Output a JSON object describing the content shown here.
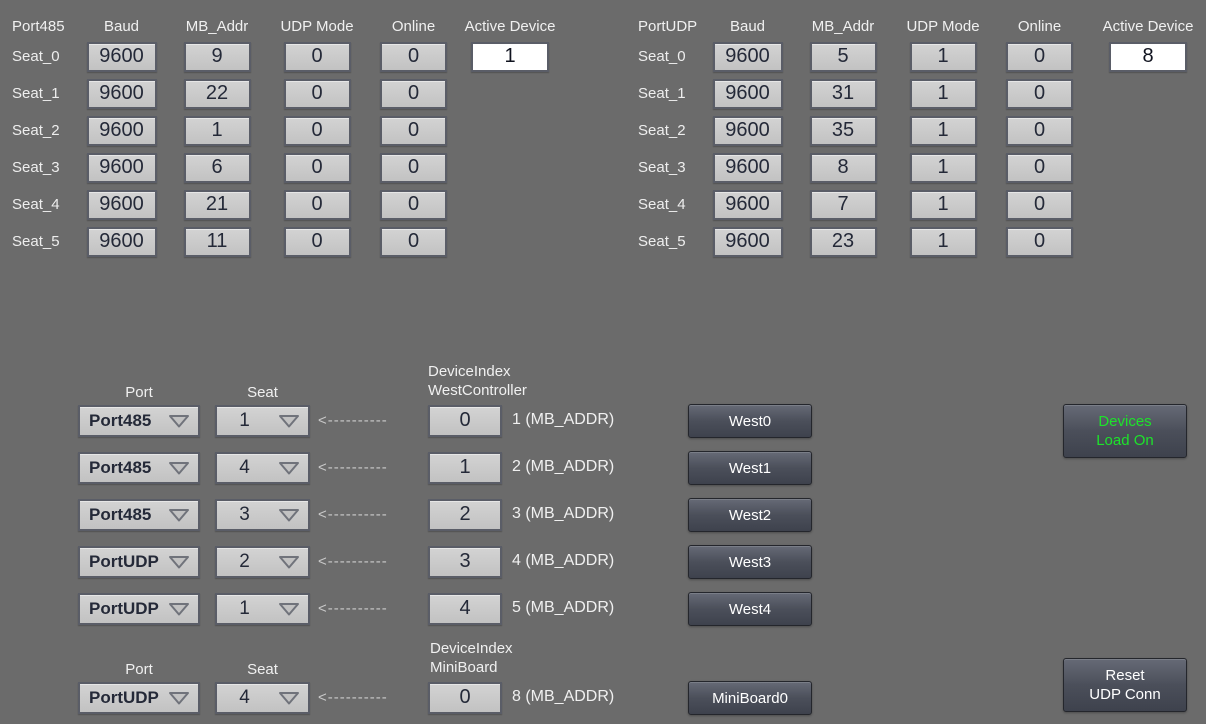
{
  "port485": {
    "title": "Port485",
    "columns": [
      "Baud",
      "MB_Addr",
      "UDP Mode",
      "Online",
      "Active Device"
    ],
    "active_device": "1",
    "rows": [
      {
        "label": "Seat_0",
        "baud": "9600",
        "mb_addr": "9",
        "udp_mode": "0",
        "online": "0"
      },
      {
        "label": "Seat_1",
        "baud": "9600",
        "mb_addr": "22",
        "udp_mode": "0",
        "online": "0"
      },
      {
        "label": "Seat_2",
        "baud": "9600",
        "mb_addr": "1",
        "udp_mode": "0",
        "online": "0"
      },
      {
        "label": "Seat_3",
        "baud": "9600",
        "mb_addr": "6",
        "udp_mode": "0",
        "online": "0"
      },
      {
        "label": "Seat_4",
        "baud": "9600",
        "mb_addr": "21",
        "udp_mode": "0",
        "online": "0"
      },
      {
        "label": "Seat_5",
        "baud": "9600",
        "mb_addr": "11",
        "udp_mode": "0",
        "online": "0"
      }
    ]
  },
  "portudp": {
    "title": "PortUDP",
    "columns": [
      "Baud",
      "MB_Addr",
      "UDP Mode",
      "Online",
      "Active Device"
    ],
    "active_device": "8",
    "rows": [
      {
        "label": "Seat_0",
        "baud": "9600",
        "mb_addr": "5",
        "udp_mode": "1",
        "online": "0"
      },
      {
        "label": "Seat_1",
        "baud": "9600",
        "mb_addr": "31",
        "udp_mode": "1",
        "online": "0"
      },
      {
        "label": "Seat_2",
        "baud": "9600",
        "mb_addr": "35",
        "udp_mode": "1",
        "online": "0"
      },
      {
        "label": "Seat_3",
        "baud": "9600",
        "mb_addr": "8",
        "udp_mode": "1",
        "online": "0"
      },
      {
        "label": "Seat_4",
        "baud": "9600",
        "mb_addr": "7",
        "udp_mode": "1",
        "online": "0"
      },
      {
        "label": "Seat_5",
        "baud": "9600",
        "mb_addr": "23",
        "udp_mode": "1",
        "online": "0"
      }
    ]
  },
  "mapping": {
    "port_header": "Port",
    "seat_header": "Seat",
    "device_index_title": "DeviceIndex",
    "device_index_subtitle": "WestController",
    "arrow": "<----------",
    "rows": [
      {
        "port": "Port485",
        "seat": "1",
        "device_index": "0",
        "mb_label": "1 (MB_ADDR)",
        "button": "West0"
      },
      {
        "port": "Port485",
        "seat": "4",
        "device_index": "1",
        "mb_label": "2 (MB_ADDR)",
        "button": "West1"
      },
      {
        "port": "Port485",
        "seat": "3",
        "device_index": "2",
        "mb_label": "3 (MB_ADDR)",
        "button": "West2"
      },
      {
        "port": "PortUDP",
        "seat": "2",
        "device_index": "3",
        "mb_label": "4 (MB_ADDR)",
        "button": "West3"
      },
      {
        "port": "PortUDP",
        "seat": "1",
        "device_index": "4",
        "mb_label": "5 (MB_ADDR)",
        "button": "West4"
      }
    ]
  },
  "miniboard": {
    "port_header": "Port",
    "seat_header": "Seat",
    "device_index_title": "DeviceIndex",
    "device_index_subtitle": "MiniBoard",
    "arrow": "<----------",
    "port": "PortUDP",
    "seat": "4",
    "device_index": "0",
    "mb_label": "8 (MB_ADDR)",
    "button": "MiniBoard0"
  },
  "side_buttons": {
    "devices_load_line1": "Devices",
    "devices_load_line2": "Load On",
    "reset_udp_line1": "Reset",
    "reset_udp_line2": "UDP Conn"
  },
  "colors": {
    "background": "#6b6b6b",
    "field_bg": "#c9c9c9",
    "field_border": "#5a5d67",
    "field_text": "#242938",
    "label_text": "#f0f0f0",
    "button_text": "#ffffff",
    "active_green": "#1de32b",
    "input_bg": "#ffffff"
  }
}
